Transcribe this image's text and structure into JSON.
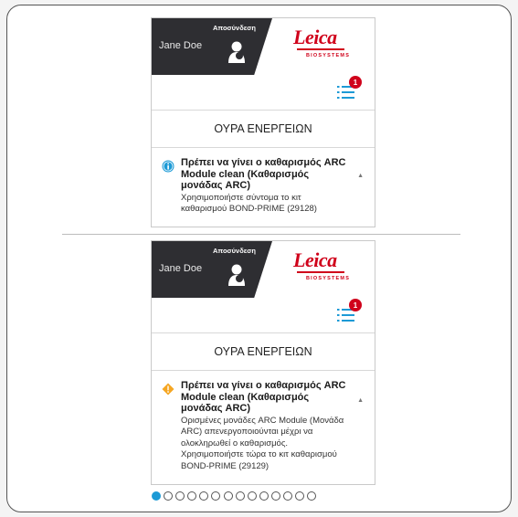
{
  "colors": {
    "brand_red": "#d0021b",
    "info_blue": "#1c9ad6",
    "warning_orange": "#f5a623",
    "dark_panel": "#2e2e32"
  },
  "screens": [
    {
      "user_name": "Jane Doe",
      "logout_label": "Αποσύνδεση",
      "logo_text": "Leica",
      "logo_subtext": "BIOSYSTEMS",
      "badge_count": "1",
      "queue_title": "ΟΥΡΑ ΕΝΕΡΓΕΙΩΝ",
      "item": {
        "icon": "info-icon",
        "title": "Πρέπει να γίνει ο καθαρισμός ARC Module clean (Καθαρισμός μονάδας ARC)",
        "body": "Χρησιμοποιήστε σύντομα το κιτ καθαρισμού BOND-PRIME (29128)"
      }
    },
    {
      "user_name": "Jane Doe",
      "logout_label": "Αποσύνδεση",
      "logo_text": "Leica",
      "logo_subtext": "BIOSYSTEMS",
      "badge_count": "1",
      "queue_title": "ΟΥΡΑ ΕΝΕΡΓΕΙΩΝ",
      "item": {
        "icon": "warning-icon",
        "title": "Πρέπει να γίνει ο καθαρισμός ARC Module clean (Καθαρισμός μονάδας ARC)",
        "body": "Ορισμένες μονάδες ARC Module (Μονάδα ARC) απενεργοποιούνται μέχρι να ολοκληρωθεί ο καθαρισμός. Χρησιμοποιήστε τώρα το κιτ καθαρισμού BOND-PRIME (29129)"
      }
    }
  ],
  "pagination": {
    "total": 14,
    "current": 1
  }
}
